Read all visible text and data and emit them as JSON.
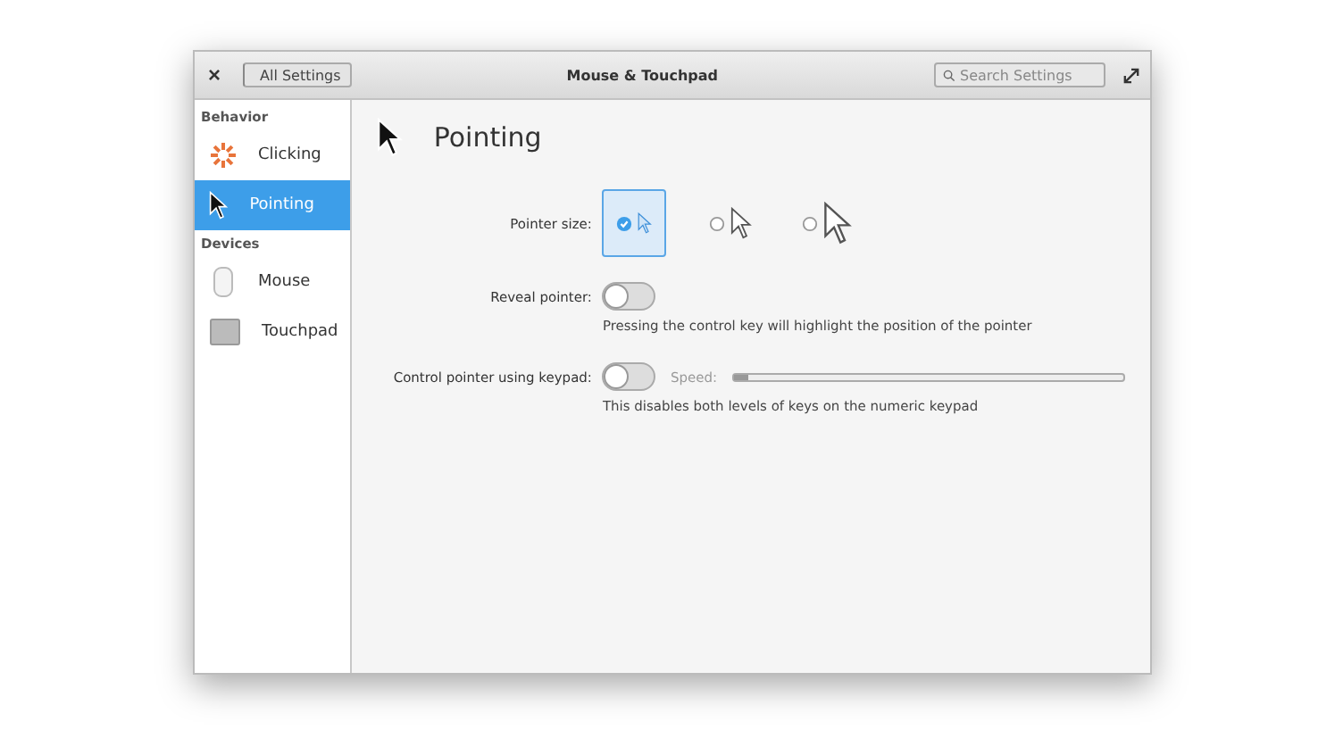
{
  "window": {
    "close": "×",
    "back": "All Settings",
    "title": "Mouse & Touchpad",
    "search": {
      "placeholder": "Search Settings"
    }
  },
  "sidebar": [
    {
      "heading": "Behavior",
      "items": [
        {
          "label": "Clicking",
          "kind": "clicking",
          "selected": false
        },
        {
          "label": "Pointing",
          "kind": "pointer",
          "selected": true
        }
      ]
    },
    {
      "heading": "Devices",
      "items": [
        {
          "label": "Mouse",
          "kind": "mouse",
          "selected": false
        },
        {
          "label": "Touchpad",
          "kind": "touchpad",
          "selected": false
        }
      ]
    }
  ],
  "page": {
    "title": "Pointing",
    "pointer_size": {
      "label": "Pointer size:",
      "options": [
        {
          "kind": "small",
          "selected": true
        },
        {
          "kind": "medium",
          "selected": false
        },
        {
          "kind": "large",
          "selected": false
        }
      ]
    },
    "reveal": {
      "label": "Reveal pointer:",
      "on": false,
      "hint": "Pressing the control key will highlight the position of the pointer"
    },
    "keypad": {
      "label": "Control pointer using keypad:",
      "on": false,
      "speed_label": "Speed:",
      "speed": {
        "level": 0.04,
        "disabled": true
      },
      "hint": "This disables both levels of keys on the numeric keypad"
    }
  }
}
